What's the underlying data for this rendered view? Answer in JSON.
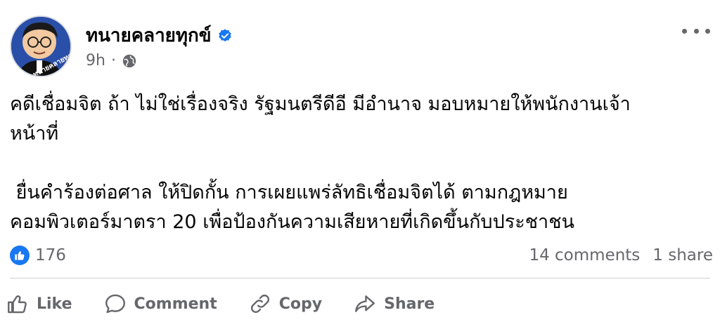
{
  "post": {
    "author": "ทนายคลายทุกข์",
    "timestamp": "9h",
    "audience_icon": "globe-icon",
    "avatar_caption": "ทนายคลายทุกข์",
    "text_lines": [
      "คดีเชื่อมจิต ถ้า ไม่ใช่เรื่องจริง รัฐมนตรีดีอี มีอำนาจ มอบหมายให้พนักงานเจ้า",
      "หน้าที่",
      " ยื่นคำร้องต่อศาล ให้ปิดกั้น การเผยแพร่ลัทธิเชื่อมจิตได้ ตามกฎหมาย",
      "คอมพิวเตอร์มาตรา 20 เพื่อป้องกันความเสียหายที่เกิดขึ้นกับประชาชน"
    ]
  },
  "stats": {
    "likes": "176",
    "comments": "14 comments",
    "shares": "1 share"
  },
  "actions": {
    "like": "Like",
    "comment": "Comment",
    "copy": "Copy",
    "share": "Share"
  },
  "colors": {
    "accent": "#1877f2",
    "secondary_text": "#65676b"
  }
}
